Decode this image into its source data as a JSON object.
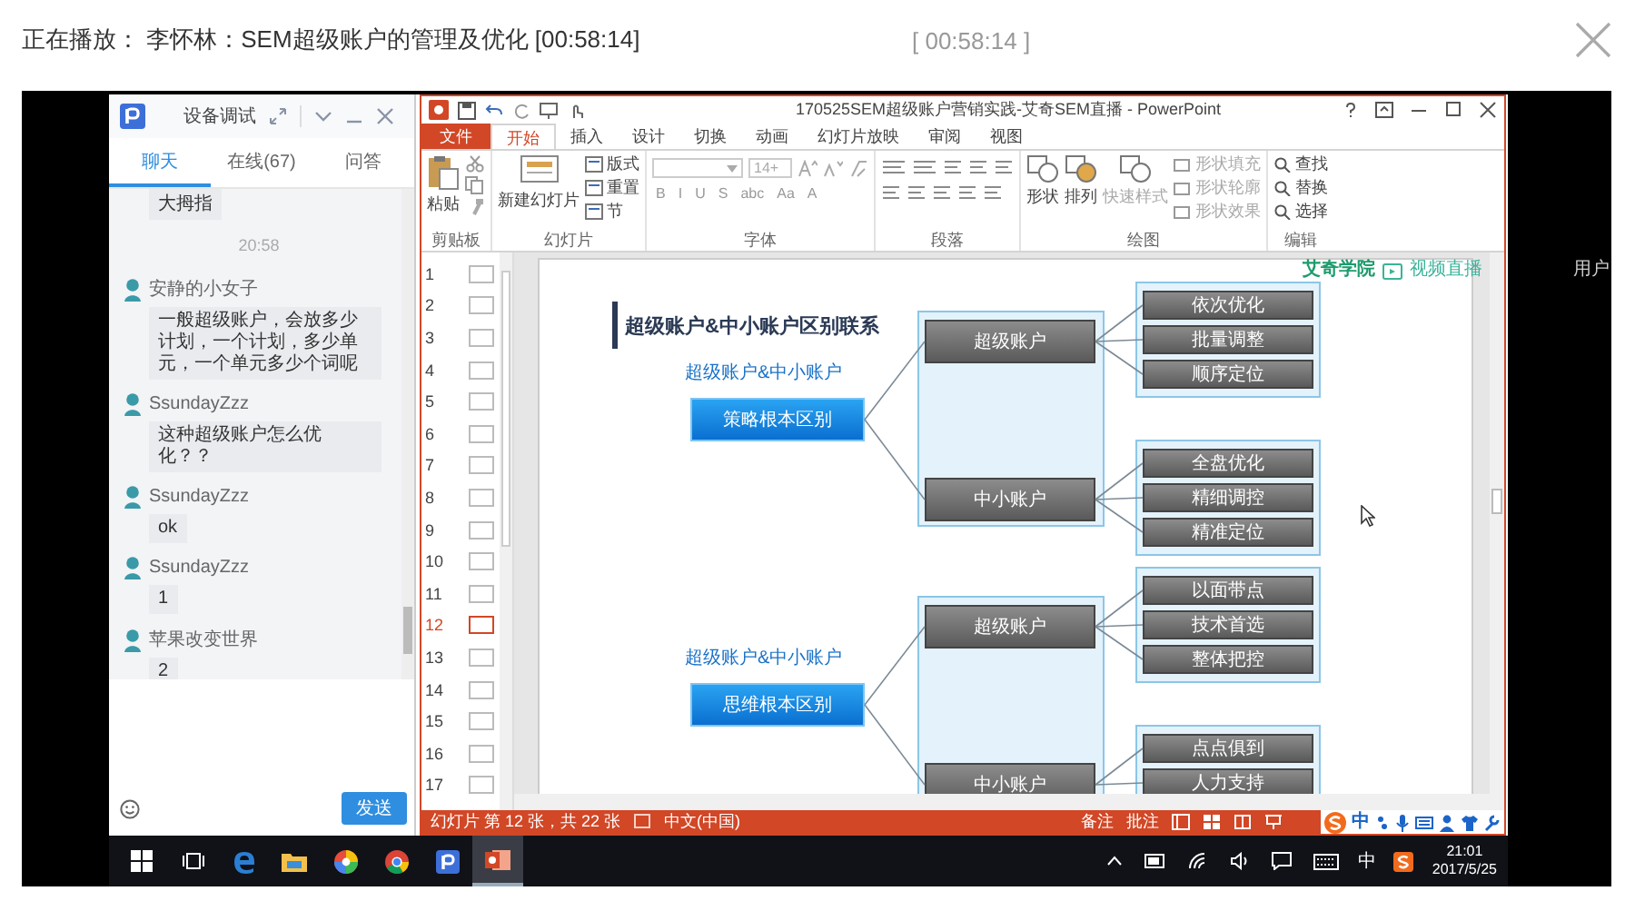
{
  "player": {
    "now_playing": "正在播放： 李怀林：SEM超级账户的管理及优化 [00:58:14]",
    "timestamp": "[ 00:58:14 ]"
  },
  "side_text": "用户",
  "chat": {
    "title": "设备调试",
    "tabs": [
      {
        "label": "聊天",
        "selected": true
      },
      {
        "label": "在线(67)",
        "selected": false
      },
      {
        "label": "问答",
        "selected": false
      }
    ],
    "messages": [
      {
        "kind": "text",
        "text": "大拇指"
      },
      {
        "kind": "time",
        "text": "20:58"
      },
      {
        "kind": "message",
        "user": "安静的小女子",
        "text": "一般超级账户，会放多少计划，一个计划，多少单元，一个单元多少个词呢"
      },
      {
        "kind": "message",
        "user": "SsundayZzz",
        "text": "这种超级账户怎么优化？？"
      },
      {
        "kind": "message",
        "user": "SsundayZzz",
        "text": "ok"
      },
      {
        "kind": "message",
        "user": "SsundayZzz",
        "text": "1"
      },
      {
        "kind": "message",
        "user": "苹果改变世界",
        "text": "2"
      }
    ],
    "send_button": "发送"
  },
  "powerpoint": {
    "title": "170525SEM超级账户营销实践-艾奇SEM直播 - PowerPoint",
    "tabs": [
      {
        "label": "文件",
        "kind": "file",
        "selected": false
      },
      {
        "label": "开始",
        "kind": "tab",
        "selected": true
      },
      {
        "label": "插入",
        "kind": "tab",
        "selected": false
      },
      {
        "label": "设计",
        "kind": "tab",
        "selected": false
      },
      {
        "label": "切换",
        "kind": "tab",
        "selected": false
      },
      {
        "label": "动画",
        "kind": "tab",
        "selected": false
      },
      {
        "label": "幻灯片放映",
        "kind": "tab",
        "selected": false
      },
      {
        "label": "审阅",
        "kind": "tab",
        "selected": false
      },
      {
        "label": "视图",
        "kind": "tab",
        "selected": false
      }
    ],
    "ribbon": [
      {
        "label": "剪贴板",
        "buttons": [
          {
            "label": "粘贴"
          }
        ]
      },
      {
        "label": "幻灯片",
        "buttons": [
          {
            "label": "新建幻灯片"
          },
          {
            "label": "版式"
          },
          {
            "label": "重置"
          },
          {
            "label": "节"
          }
        ]
      },
      {
        "label": "字体",
        "font_size": "14+",
        "format_buttons": [
          "B",
          "I",
          "U",
          "S",
          "abc",
          "Aa",
          "A"
        ]
      },
      {
        "label": "段落"
      },
      {
        "label": "绘图",
        "buttons": [
          {
            "label": "形状",
            "disabled": false
          },
          {
            "label": "排列",
            "disabled": false
          },
          {
            "label": "快速样式",
            "disabled": true
          },
          {
            "label": "形状填充",
            "disabled": true
          },
          {
            "label": "形状轮廓",
            "disabled": true
          },
          {
            "label": "形状效果",
            "disabled": true
          }
        ]
      },
      {
        "label": "编辑",
        "buttons": [
          {
            "label": "查找"
          },
          {
            "label": "替换"
          },
          {
            "label": "选择"
          }
        ]
      }
    ],
    "thumbnails": [
      {
        "number": "1",
        "selected": false
      },
      {
        "number": "2",
        "selected": false
      },
      {
        "number": "3",
        "selected": false
      },
      {
        "number": "4",
        "selected": false
      },
      {
        "number": "5",
        "selected": false
      },
      {
        "number": "6",
        "selected": false
      },
      {
        "number": "7",
        "selected": false
      },
      {
        "number": "8",
        "selected": false
      },
      {
        "number": "9",
        "selected": false
      },
      {
        "number": "10",
        "selected": false
      },
      {
        "number": "11",
        "selected": false
      },
      {
        "number": "12",
        "selected": true
      },
      {
        "number": "13",
        "selected": false
      },
      {
        "number": "14",
        "selected": false
      },
      {
        "number": "15",
        "selected": false
      },
      {
        "number": "16",
        "selected": false
      },
      {
        "number": "17",
        "selected": false
      }
    ],
    "slide": {
      "title": "超级账户&中小账户区别联系",
      "logos": [
        "艾奇学院",
        "视频直播"
      ],
      "sections": [
        {
          "caption": "超级账户&中小账户",
          "root": "策略根本区别",
          "branches": [
            {
              "label": "超级账户",
              "leaves": [
                "依次优化",
                "批量调整",
                "顺序定位"
              ]
            },
            {
              "label": "中小账户",
              "leaves": [
                "全盘优化",
                "精细调控",
                "精准定位"
              ]
            }
          ]
        },
        {
          "caption": "超级账户&中小账户",
          "root": "思维根本区别",
          "branches": [
            {
              "label": "超级账户",
              "leaves": [
                "以面带点",
                "技术首选",
                "整体把控"
              ]
            },
            {
              "label": "中小账户",
              "leaves": [
                "点点俱到",
                "人力支持"
              ]
            }
          ]
        }
      ]
    },
    "status_bar": {
      "slide_info": "幻灯片 第 12 张，共 22 张",
      "language": "中文(中国)",
      "notes": "备注",
      "comments": "批注",
      "ime_mode": "中"
    }
  },
  "taskbar": {
    "apps": [
      {
        "kind": "start",
        "active": false
      },
      {
        "kind": "task_view",
        "active": false
      },
      {
        "kind": "edge",
        "active": false
      },
      {
        "kind": "explorer",
        "active": false
      },
      {
        "kind": "photos",
        "active": false
      },
      {
        "kind": "chrome",
        "active": false
      },
      {
        "kind": "chat_app",
        "active": false
      },
      {
        "kind": "powerpoint",
        "active": true
      }
    ],
    "input_mode": "中",
    "time": "21:01",
    "date": "2017/5/25"
  }
}
